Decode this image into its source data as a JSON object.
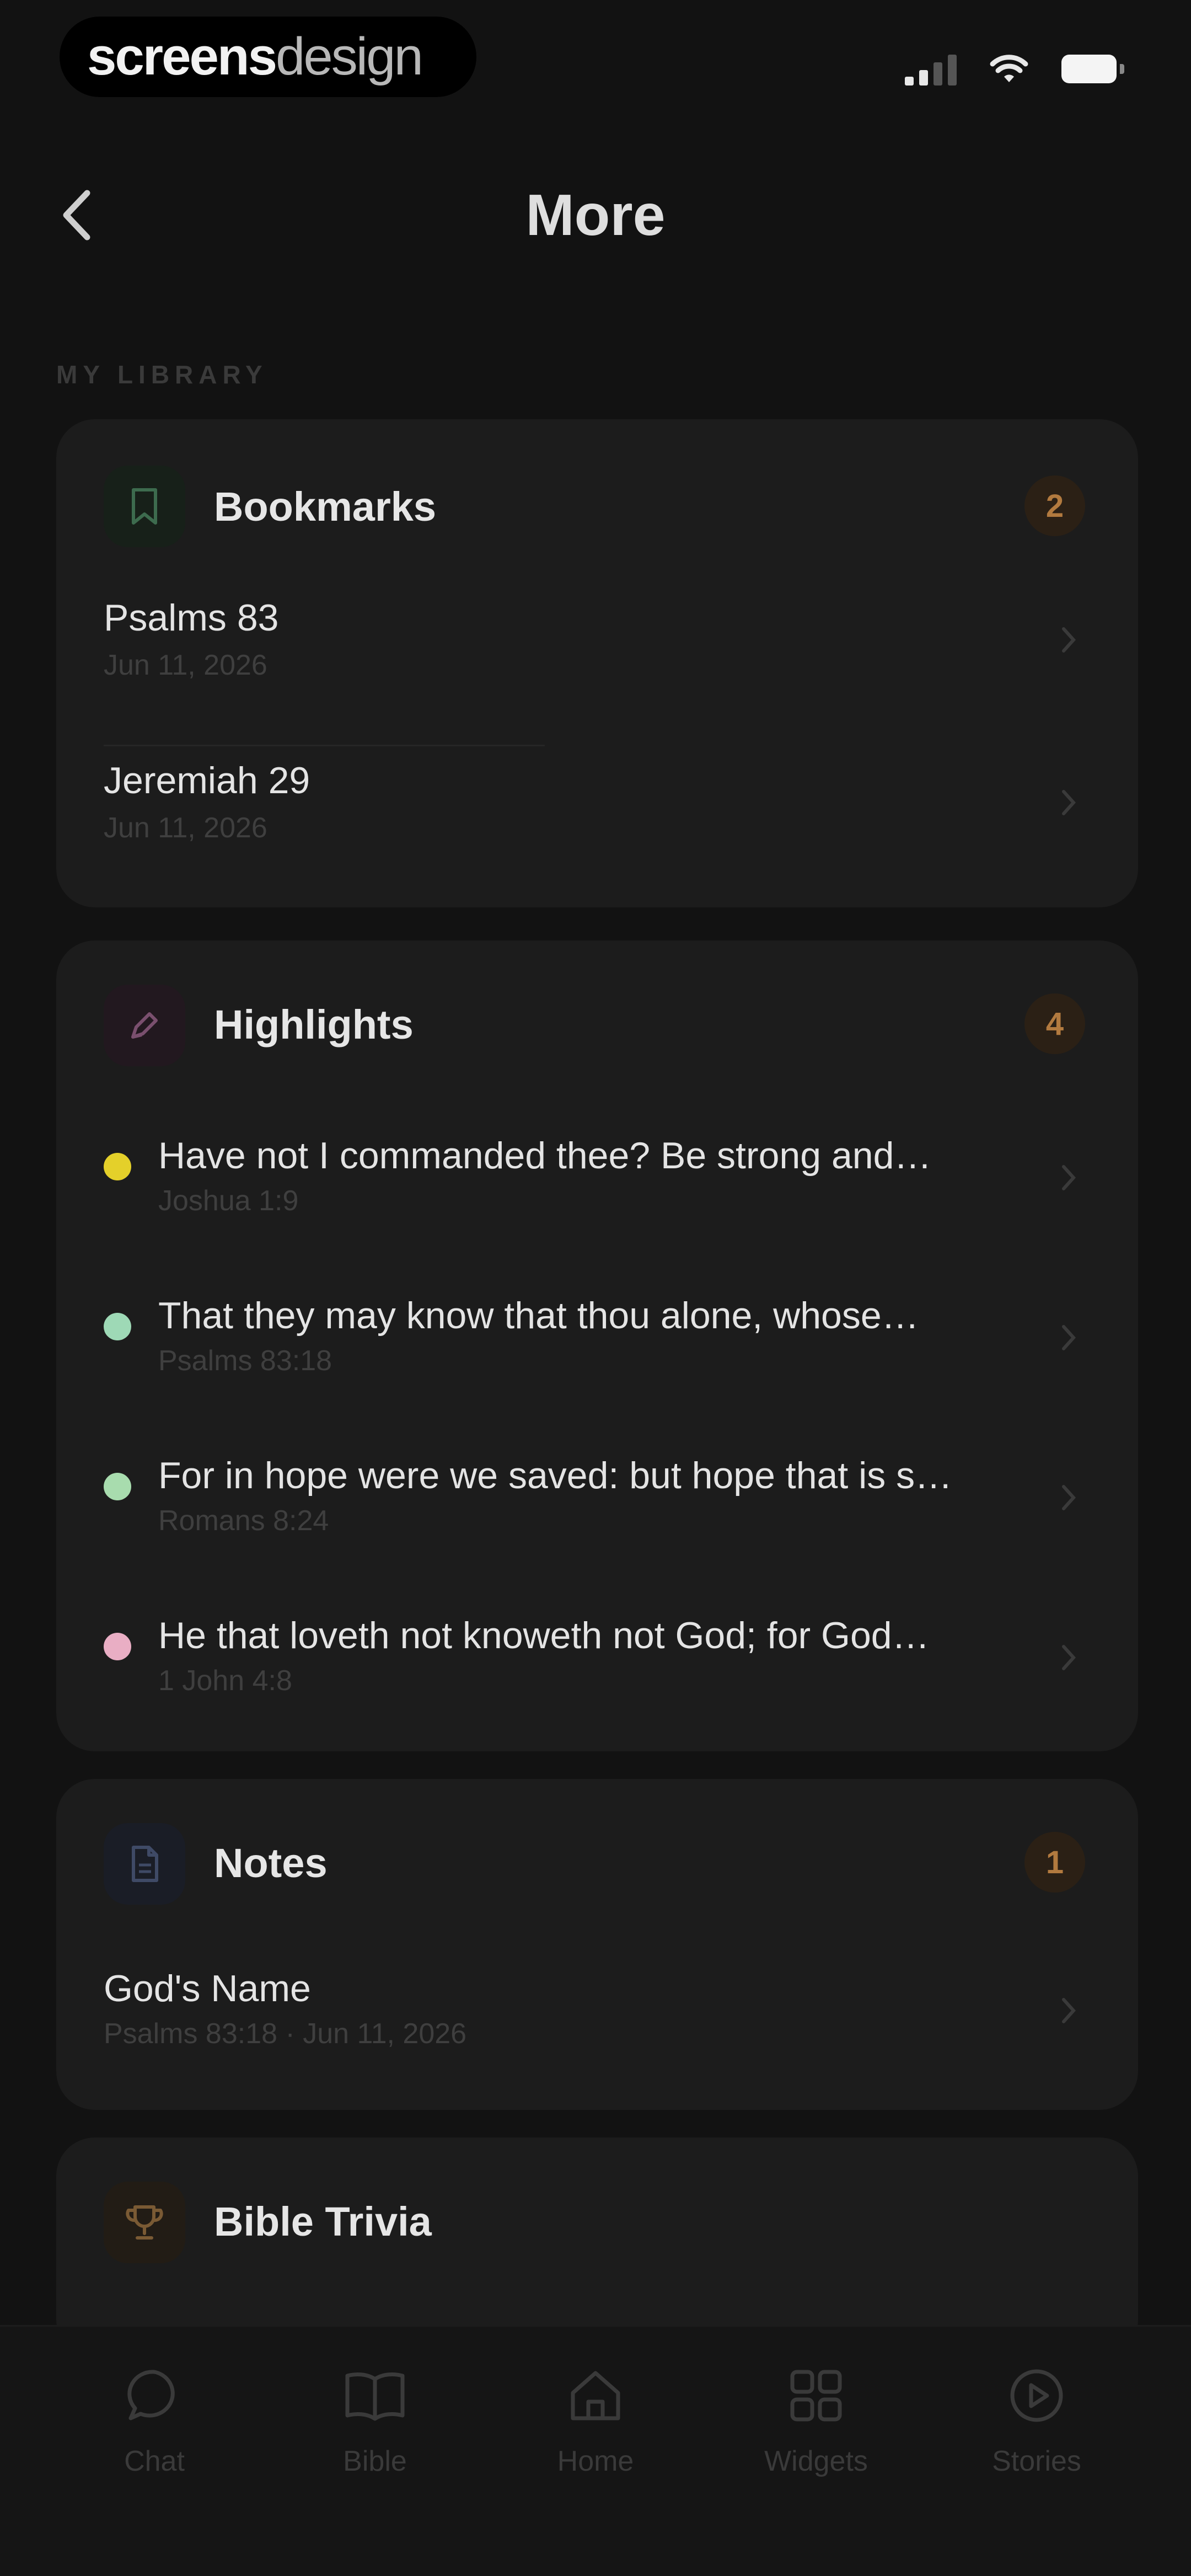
{
  "status_bar": {
    "brand_bold": "screens",
    "brand_light": "design"
  },
  "header": {
    "title": "More"
  },
  "section_label": "MY LIBRARY",
  "bookmarks": {
    "title": "Bookmarks",
    "count": "2",
    "icon": "bookmark-icon",
    "items": [
      {
        "title": "Psalms 83",
        "date": "Jun 11, 2026"
      },
      {
        "title": "Jeremiah 29",
        "date": "Jun 11, 2026"
      }
    ]
  },
  "highlights": {
    "title": "Highlights",
    "count": "4",
    "icon": "highlighter-icon",
    "items": [
      {
        "text": "Have not I commanded thee? Be strong and…",
        "ref": "Joshua 1:9",
        "color": "#e4d02a"
      },
      {
        "text": "That they may know that thou alone, whose…",
        "ref": "Psalms 83:18",
        "color": "#9ed9b6"
      },
      {
        "text": "For in hope were we saved: but hope that is s…",
        "ref": "Romans 8:24",
        "color": "#a8dcae"
      },
      {
        "text": "He that loveth not knoweth not God; for God…",
        "ref": "1 John 4:8",
        "color": "#e9aec4"
      }
    ]
  },
  "notes": {
    "title": "Notes",
    "count": "1",
    "icon": "document-icon",
    "items": [
      {
        "title": "God's Name",
        "meta": "Psalms 83:18 · Jun 11, 2026"
      }
    ]
  },
  "trivia": {
    "title": "Bible Trivia",
    "icon": "trophy-icon"
  },
  "tabs": [
    {
      "label": "Chat",
      "icon": "chat-icon"
    },
    {
      "label": "Bible",
      "icon": "book-icon"
    },
    {
      "label": "Home",
      "icon": "home-icon"
    },
    {
      "label": "Widgets",
      "icon": "widgets-icon"
    },
    {
      "label": "Stories",
      "icon": "play-icon"
    }
  ],
  "colors": {
    "background": "#121212",
    "card": "#1c1c1c",
    "badge_text": "#b27a3f",
    "badge_bg": "#2b2015"
  }
}
